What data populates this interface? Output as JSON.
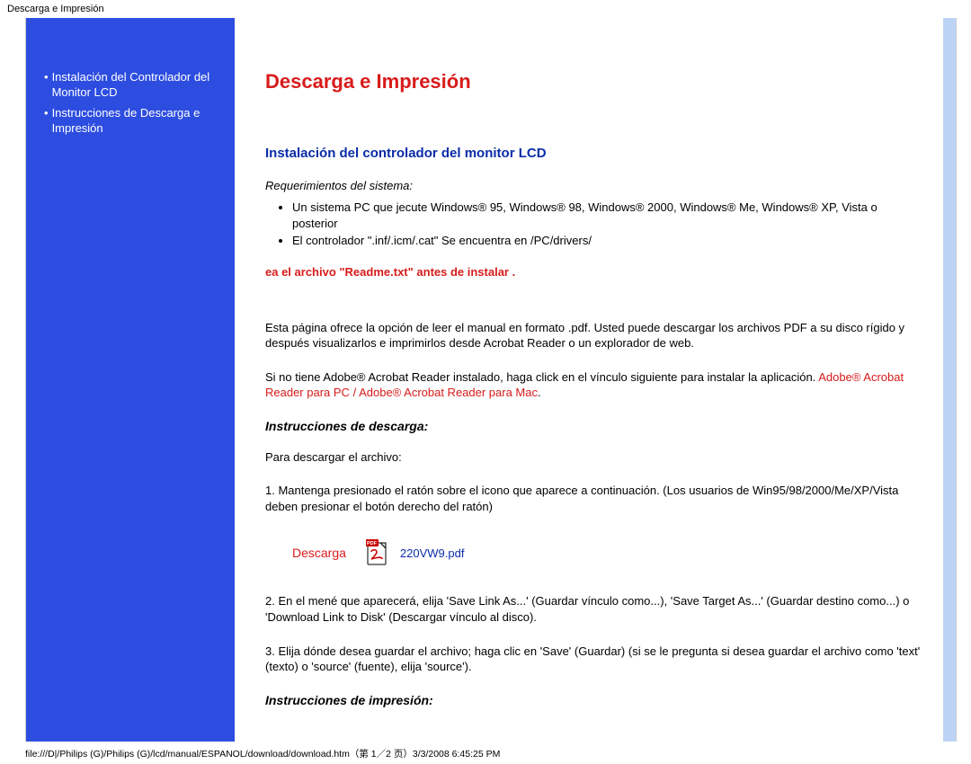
{
  "header": {
    "title": "Descarga e Impresión"
  },
  "sidebar": {
    "items": [
      {
        "label": "Instalación del Controlador del Monitor LCD"
      },
      {
        "label": "Instrucciones de Descarga e Impresión"
      }
    ]
  },
  "main": {
    "title": "Descarga e Impresión",
    "section1": {
      "heading": "Instalación del controlador del monitor LCD",
      "reqs_head": "Requerimientos del sistema:",
      "reqs": [
        "Un sistema PC que jecute Windows® 95, Windows® 98, Windows® 2000, Windows® Me, Windows® XP, Vista o posterior",
        "El controlador \".inf/.icm/.cat\" Se encuentra en /PC/drivers/"
      ],
      "warn": "ea el archivo \"Readme.txt\" antes de instalar .",
      "para1": "Esta página ofrece la opción de leer el manual en formato .pdf. Usted puede descargar los archivos PDF a su disco rígido y después visualizarlos e imprimirlos desde Acrobat Reader o un explorador de web.",
      "para2a": "Si no tiene Adobe® Acrobat Reader instalado, haga click en el vínculo siguiente para instalar la aplicación. ",
      "para2_link1": "Adobe® Acrobat Reader para PC",
      "para2_sep": " / ",
      "para2_link2": "Adobe® Acrobat Reader para Mac",
      "para2_end": "."
    },
    "section2": {
      "heading": "Instrucciones de descarga:",
      "p1": "Para descargar el archivo:",
      "step1": "1. Mantenga presionado el ratón sobre el icono que aparece a continuación. (Los usuarios de Win95/98/2000/Me/XP/Vista deben presionar el botón derecho del ratón)",
      "download_label": "Descarga",
      "pdf_name": "220VW9.pdf",
      "pdf_icon": "pdf-icon",
      "step2": "2. En el mené que aparecerá, elija 'Save Link As...' (Guardar vínculo como...), 'Save Target As...' (Guardar destino como...) o 'Download Link to Disk' (Descargar vínculo al disco).",
      "step3": "3. Elija dónde desea guardar el archivo; haga clic en 'Save' (Guardar) (si se le pregunta si desea guardar el archivo como 'text' (texto) o 'source' (fuente), elija 'source')."
    },
    "section3": {
      "heading": "Instrucciones de impresión:"
    }
  },
  "footer": {
    "text": "file:///D|/Philips (G)/Philips (G)/lcd/manual/ESPANOL/download/download.htm（第 1／2 页）3/3/2008 6:45:25 PM"
  }
}
